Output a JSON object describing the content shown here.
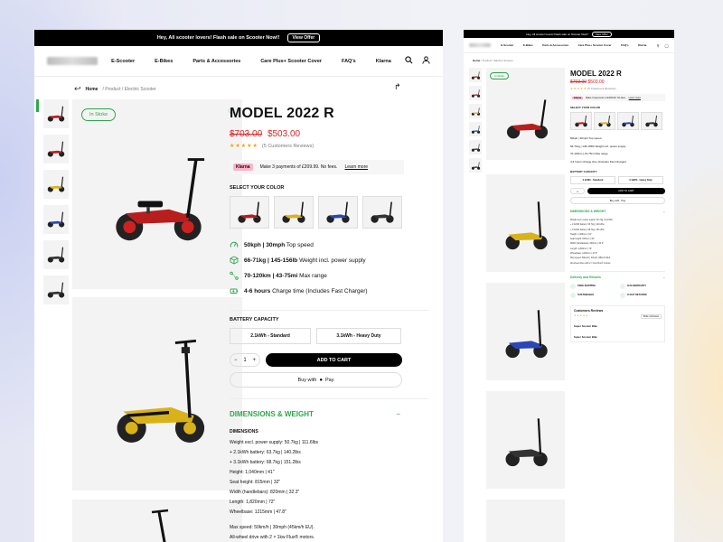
{
  "promo": {
    "text": "Hey, All scooter lovers! Flash sale on Scooter Now!!",
    "button": "View Offer"
  },
  "nav": {
    "items": [
      "E-Scooter",
      "E-Bikes",
      "Parts & Accessories",
      "Care Plus+ Scooter Cover",
      "FAQ's",
      "Klarna"
    ]
  },
  "breadcrumb": {
    "home": "Home",
    "rest": "/ Product / Electric Scooter"
  },
  "product": {
    "badge": "In Stoke",
    "title": "MODEL 2022 R",
    "old_price": "$703.00",
    "price": "$503.00",
    "stars": "★★★★★",
    "reviews": "(5 Customers Reviews)",
    "klarna": {
      "brand": "Klarna",
      "text": "Make 3 payments of £209.99. No fees.",
      "link": "Learn more"
    },
    "color_heading": "SELECT YOUR COLOR",
    "specs": [
      {
        "icon": "speedometer-icon",
        "bold": "50kph | 30mph",
        "rest": "Top speed"
      },
      {
        "icon": "box-icon",
        "bold": "66-71kg | 145-156lb",
        "rest": "Weight incl. power supply"
      },
      {
        "icon": "route-icon",
        "bold": "70-120km | 43-75mi",
        "rest": "Max range"
      },
      {
        "icon": "battery-icon",
        "bold": "4-6 hours",
        "rest": "Charge time (Includes Fast Charger)"
      }
    ],
    "battery_heading": "BATTERY CAPACITY",
    "battery_options": [
      "2.1kWh - Standard",
      "3.1kWh - Heavy Duty"
    ],
    "qty": "1",
    "add_to_cart": "ADD TO CART",
    "buy_with": "Buy with",
    "pay": "Pay",
    "dims_heading": "DIMENSIONS & WEIGHT",
    "dims_sub": "DIMENSIONS",
    "dims": [
      "Weight excl. power supply: 50.7kg | 111.6lbs",
      "+ 2.1kWh battery: 63.7kg | 140.2lbs",
      "+ 3.1kWh battery: 68.7kg | 151.2lbs",
      "Height: 1,040mm | 41\"",
      "Seat height: 815mm | 32\"",
      "Width (handlebars): 820mm | 32.3\"",
      "Length: 1,820mm | 72\"",
      "Wheelbase: 1215mm | 47.8\""
    ],
    "dims2": [
      "Max speed: 50km/h | 30mph (45km/h EU).",
      "All-wheel drive with 2 × 1kw Flux® motors."
    ]
  },
  "right": {
    "promo": "Hey, All scooter lovers! Flash sale on Scooter Now!!",
    "promo_btn": "View Offer",
    "nav": [
      "E-Scooter",
      "E-Bikes",
      "Parts & Accessories",
      "Care Plus+ Scooter Cover",
      "FAQ's",
      "Klarna"
    ],
    "specs": [
      "50kph | 30mph Top speed",
      "66-71kg | 145-156lb Weight incl. power supply",
      "70-120km | 43-75mi Max range",
      "4-6 hours Charge time (Includes Fast Charger)"
    ],
    "battery_options": [
      "2.1kWh - Standard",
      "3.1kWh - Heavy Duty"
    ],
    "delivery_heading": "Delivery and Returns",
    "delivery_items": [
      "FREE SHIPPING",
      "12-M WARRANTY",
      "SUSTAINABLE",
      "14 DAY RETURNS"
    ],
    "reviews_heading": "Customers Reviews",
    "write_review": "Write a Review",
    "review_title": "Super Scooter Bike",
    "review_title2": "Super Scooter Bike"
  },
  "colors": {
    "accent": "#2ca84b",
    "price": "#e02020",
    "stars": "#f3a300"
  }
}
